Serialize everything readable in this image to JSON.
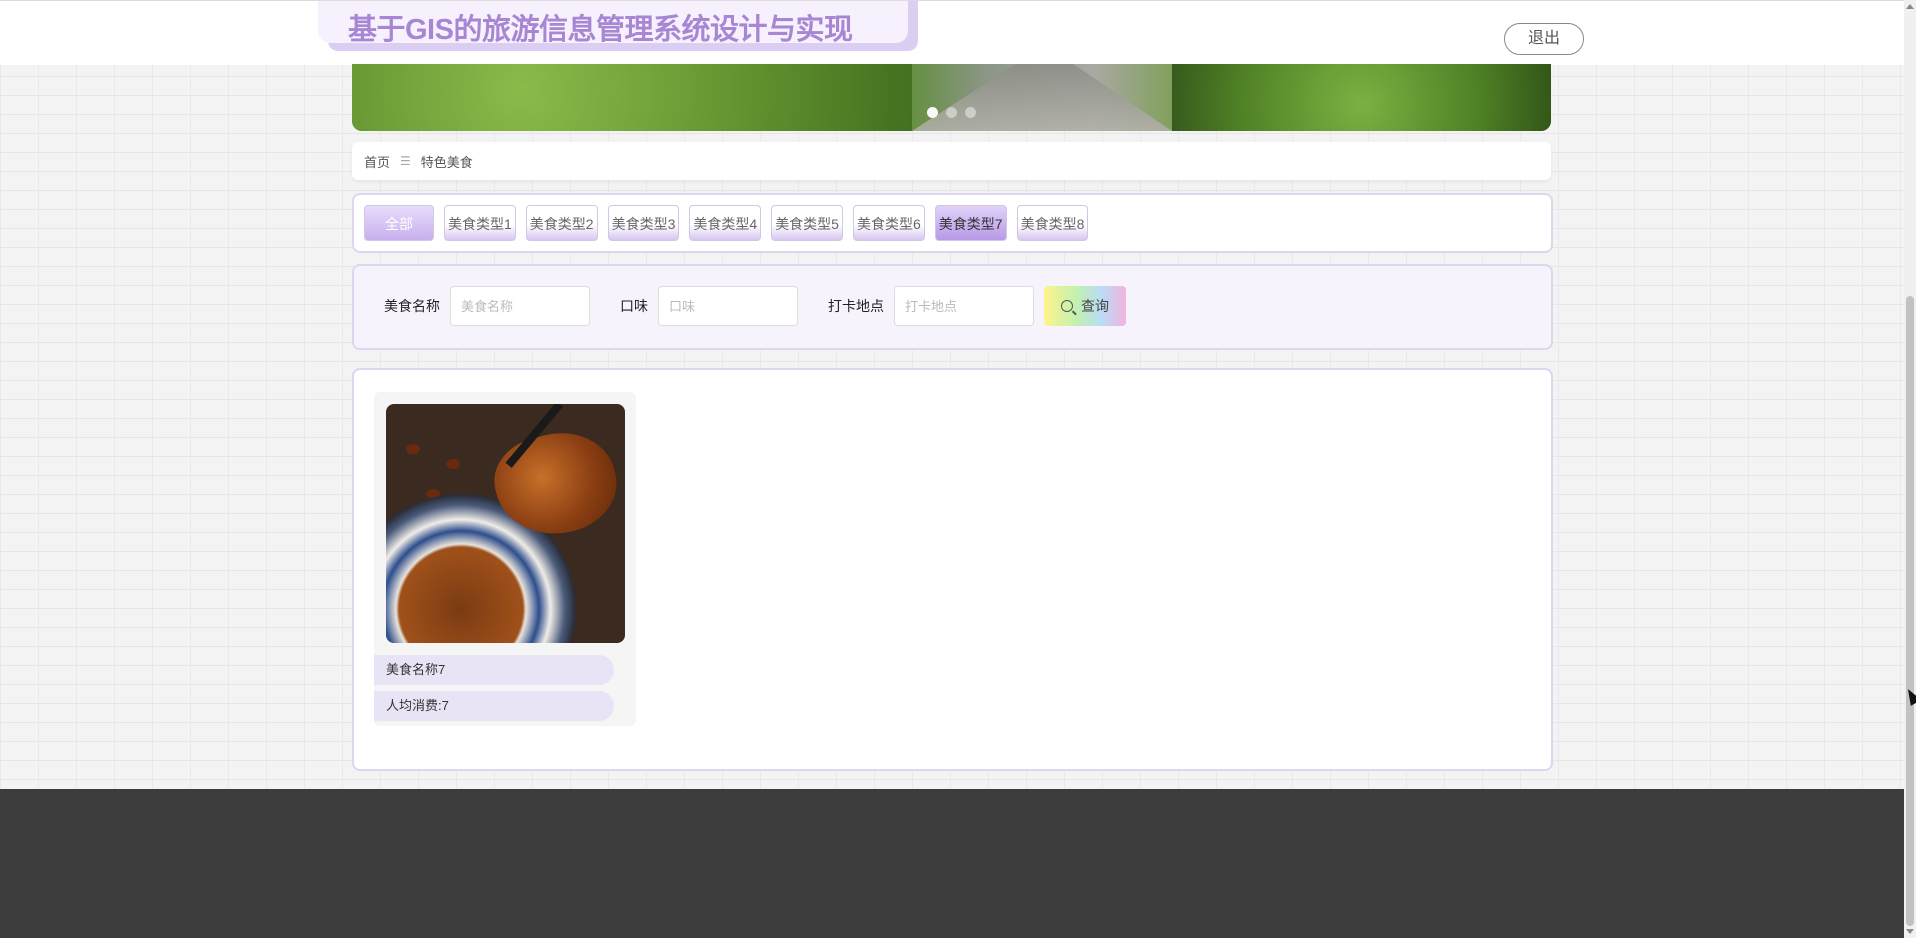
{
  "header": {
    "title": "基于GIS的旅游信息管理系统设计与实现",
    "logout_label": "退出"
  },
  "banner": {
    "slide_count": 3,
    "active_slide": 1
  },
  "breadcrumb": {
    "home": "首页",
    "separator": "☰",
    "current": "特色美食"
  },
  "types": {
    "items": [
      {
        "label": "全部",
        "state": "all"
      },
      {
        "label": "美食类型1",
        "state": "normal"
      },
      {
        "label": "美食类型2",
        "state": "normal"
      },
      {
        "label": "美食类型3",
        "state": "normal"
      },
      {
        "label": "美食类型4",
        "state": "normal"
      },
      {
        "label": "美食类型5",
        "state": "normal"
      },
      {
        "label": "美食类型6",
        "state": "normal"
      },
      {
        "label": "美食类型7",
        "state": "active"
      },
      {
        "label": "美食类型8",
        "state": "normal"
      }
    ]
  },
  "search": {
    "name_label": "美食名称",
    "name_placeholder": "美食名称",
    "taste_label": "口味",
    "taste_placeholder": "口味",
    "location_label": "打卡地点",
    "location_placeholder": "打卡地点",
    "query_label": "查询"
  },
  "foods": [
    {
      "name": "美食名称7",
      "price": "人均消费:7"
    }
  ],
  "colors": {
    "title": "#a786d4",
    "accent": "#c7b0ee",
    "footer": "#3c3c3c"
  }
}
